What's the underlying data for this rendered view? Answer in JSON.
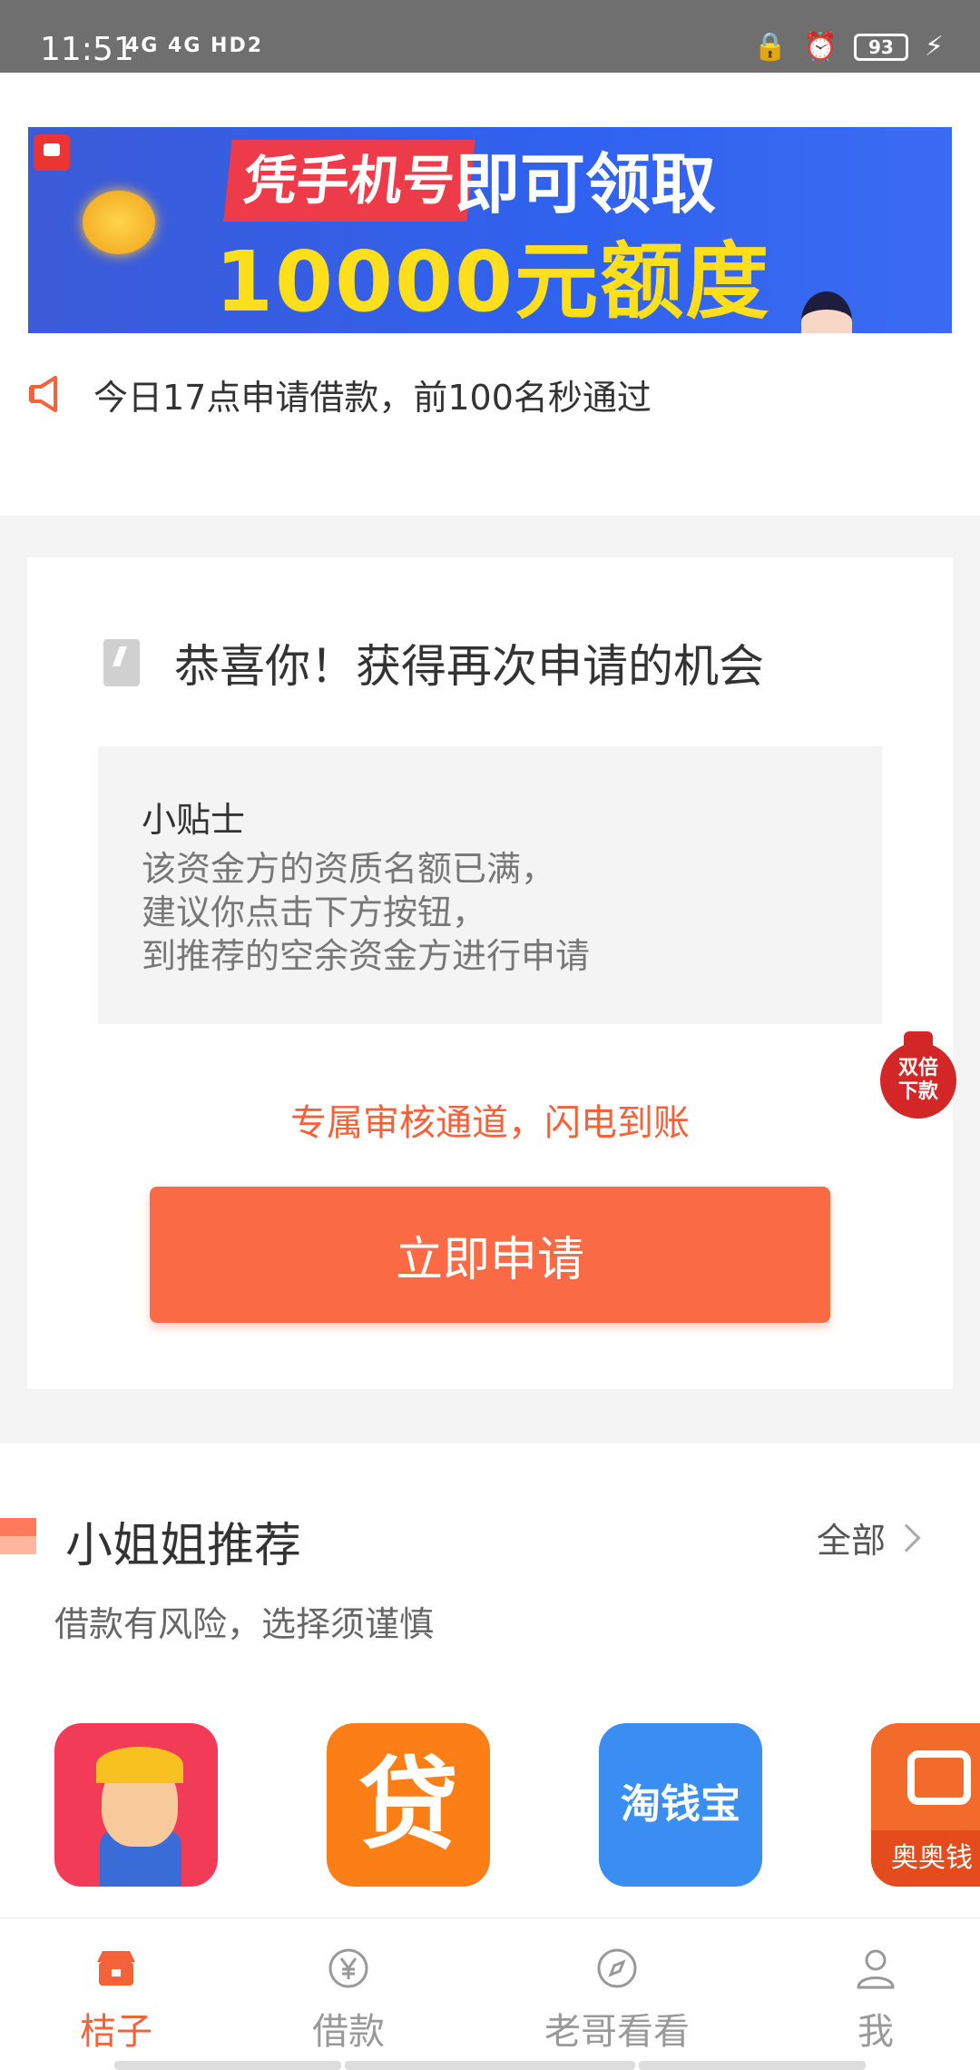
{
  "status_bar": {
    "time": "11:51",
    "network": "4G 4G HD2",
    "battery": "93"
  },
  "banner": {
    "tag": "凭手机号",
    "headline": "即可领取",
    "amount": "10000元额度"
  },
  "notice": {
    "text": "今日17点申请借款，前100名秒通过"
  },
  "card": {
    "title": "恭喜你！获得再次申请的机会",
    "tips_head": "小贴士",
    "tips_lines": [
      "该资金方的资质名额已满，",
      "建议你点击下方按钮，",
      "到推荐的空余资金方进行申请"
    ],
    "promo": "专属审核通道，闪电到账",
    "apply_button": "立即申请"
  },
  "float_badge": {
    "line1": "双倍",
    "line2": "下款"
  },
  "recommend": {
    "title": "小姐姐推荐",
    "all_label": "全部",
    "subtitle": "借款有风险，选择须谨慎",
    "apps": [
      {
        "name": "miner-app",
        "glyph": ""
      },
      {
        "name": "dai-app",
        "glyph": "贷"
      },
      {
        "name": "taoqianbao-app",
        "glyph": "淘钱宝"
      },
      {
        "name": "aoaoqian-app",
        "glyph": "奥奥钱"
      }
    ]
  },
  "tabbar": {
    "tabs": [
      {
        "label": "桔子",
        "icon": "shop-icon",
        "active": true
      },
      {
        "label": "借款",
        "icon": "yen-icon",
        "active": false
      },
      {
        "label": "老哥看看",
        "icon": "compass-icon",
        "active": false
      },
      {
        "label": "我",
        "icon": "user-icon",
        "active": false
      }
    ]
  },
  "colors": {
    "accent": "#fa6a45",
    "promo_text": "#f4623a",
    "status_bar": "#6f6f6f"
  }
}
